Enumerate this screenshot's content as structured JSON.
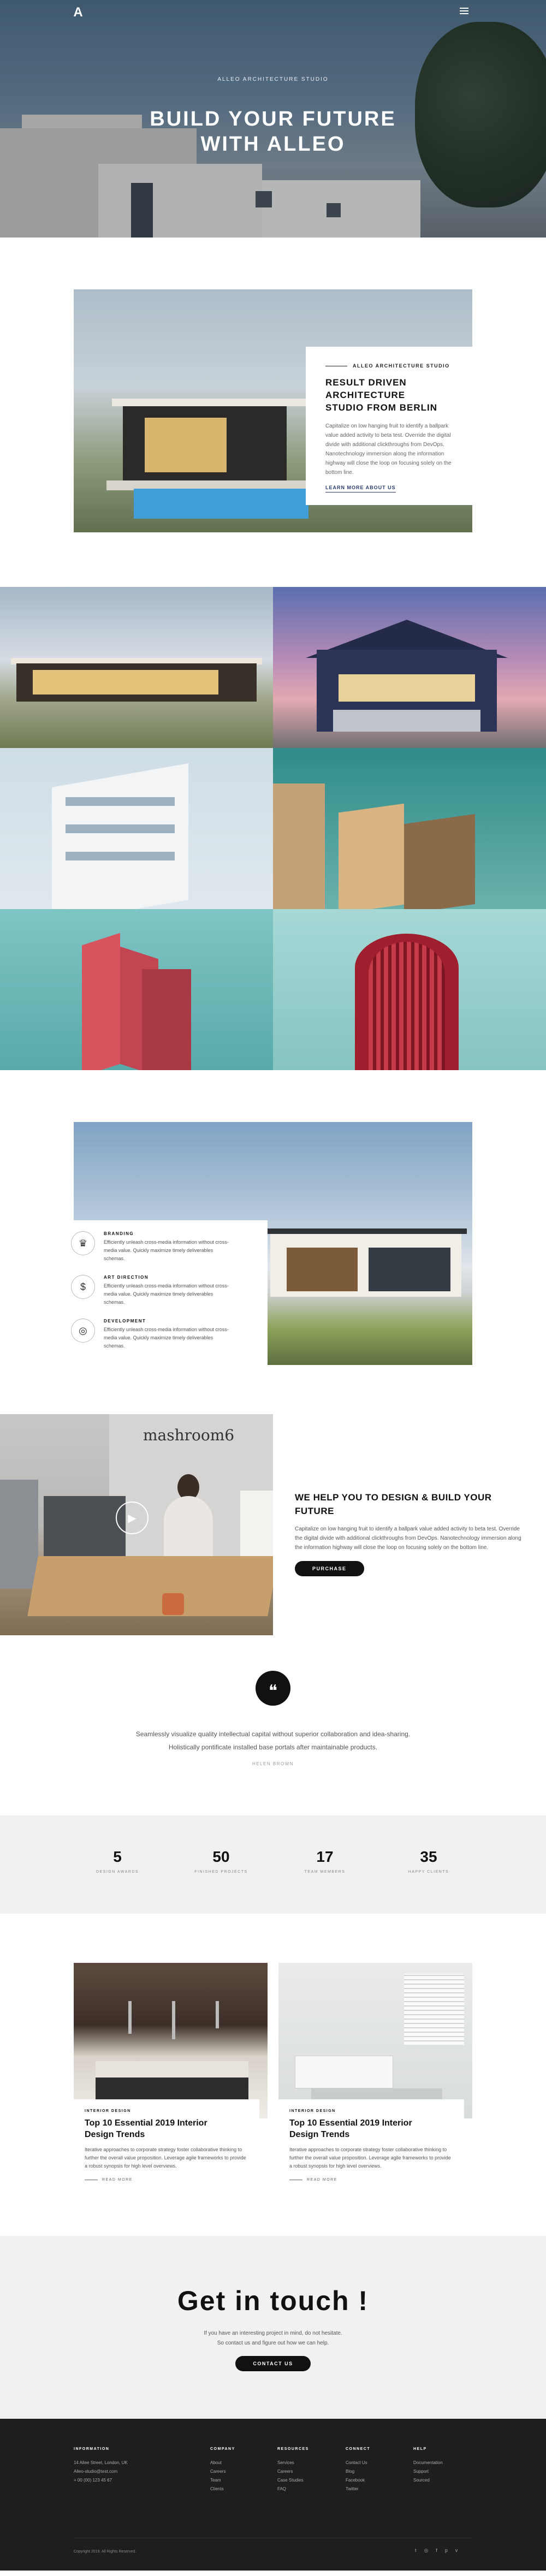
{
  "header": {
    "logo": "A",
    "eyebrow": "ALLEO ARCHITECTURE STUDIO",
    "title_line1": "BUILD YOUR FUTURE",
    "title_line2": "WITH ALLEO"
  },
  "intro": {
    "eyebrow": "ALLEO ARCHITECTURE STUDIO",
    "title_line1": "RESULT DRIVEN ARCHITECTURE",
    "title_line2": "STUDIO FROM BERLIN",
    "text": "Capitalize on low hanging fruit to identify a ballpark value added activity to beta test. Override the digital divide with additional clickthroughs from DevOps. Nanotechnology immersion along the information highway will close the loop on focusing solely on the bottom line.",
    "link": "LEARN MORE ABOUT US"
  },
  "features": [
    {
      "icon": "crown-icon",
      "glyph": "♛",
      "title": "BRANDING",
      "text": "Efficiently unleash cross-media information without cross-media value. Quickly maximize timely deliverables schemas."
    },
    {
      "icon": "dollar-icon",
      "glyph": "$",
      "title": "ART DIRECTION",
      "text": "Efficiently unleash cross-media information without cross-media value. Quickly maximize timely deliverables schemas."
    },
    {
      "icon": "bulb-icon",
      "glyph": "◎",
      "title": "DEVELOPMENT",
      "text": "Efficiently unleash cross-media information without cross-media value. Quickly maximize timely deliverables schemas."
    }
  ],
  "help": {
    "sign": "mashroom6",
    "title_line1": "WE HELP YOU TO DESIGN & BUILD YOUR",
    "title_line2": "FUTURE",
    "text": "Capitalize on low hanging fruit to identify a ballpark value added activity to beta test. Override the digital divide with additional clickthroughs from DevOps. Nanotechnology immersion along the information highway will close the loop on focusing solely on the bottom line.",
    "button": "PURCHASE"
  },
  "quote": {
    "text": "Seamlessly visualize quality intellectual capital without superior collaboration and idea-sharing. Holistically pontificate installed base portals after maintainable products.",
    "author": "HELEN BROWN"
  },
  "stats": [
    {
      "value": "5",
      "label": "DESIGN AWARDS"
    },
    {
      "value": "50",
      "label": "FINISHED PROJECTS"
    },
    {
      "value": "17",
      "label": "TEAM MEMBERS"
    },
    {
      "value": "35",
      "label": "HAPPY CLIENTS"
    }
  ],
  "posts": [
    {
      "category": "INTERIOR DESIGN",
      "title_line1": "Top 10 Essential 2019 Interior",
      "title_line2": "Design Trends",
      "text": "Iterative approaches to corporate strategy foster collaborative thinking to further the overall value proposition. Leverage agile frameworks to provide a robust synopsis for high level overviews.",
      "more": "READ MORE"
    },
    {
      "category": "INTERIOR DESIGN",
      "title_line1": "Top 10 Essential 2019 Interior",
      "title_line2": "Design Trends",
      "text": "Iterative approaches to corporate strategy foster collaborative thinking to further the overall value proposition. Leverage agile frameworks to provide a robust synopsis for high level overviews.",
      "more": "READ MORE"
    }
  ],
  "contact": {
    "title": "Get in touch !",
    "line1": "If you have an interesting project in mind, do not hesitate.",
    "line2": "So contact us and figure out how we can help.",
    "button": "CONTACT US"
  },
  "footer": {
    "info_title": "INFORMATION",
    "address": "14 Allee Street, London, UK",
    "email": "Alleo-studio@test.com",
    "phone": "+ 00 (00) 123 45 67",
    "columns": [
      {
        "title": "COMPANY",
        "items": [
          "About",
          "Careers",
          "Team",
          "Clients"
        ]
      },
      {
        "title": "RESOURCES",
        "items": [
          "Services",
          "Careers",
          "Case Studies",
          "FAQ"
        ]
      },
      {
        "title": "CONNECT",
        "items": [
          "Contact Us",
          "Blog",
          "Facebook",
          "Twitter"
        ]
      },
      {
        "title": "HELP",
        "items": [
          "Documentation",
          "Support",
          "Sourced"
        ]
      }
    ],
    "copyright": "Copyright 2019. All Rights Reserved.",
    "socials": [
      {
        "icon": "twitter-icon",
        "glyph": "t"
      },
      {
        "icon": "instagram-icon",
        "glyph": "◎"
      },
      {
        "icon": "facebook-icon",
        "glyph": "f"
      },
      {
        "icon": "pinterest-icon",
        "glyph": "p"
      },
      {
        "icon": "vimeo-icon",
        "glyph": "v"
      }
    ]
  }
}
